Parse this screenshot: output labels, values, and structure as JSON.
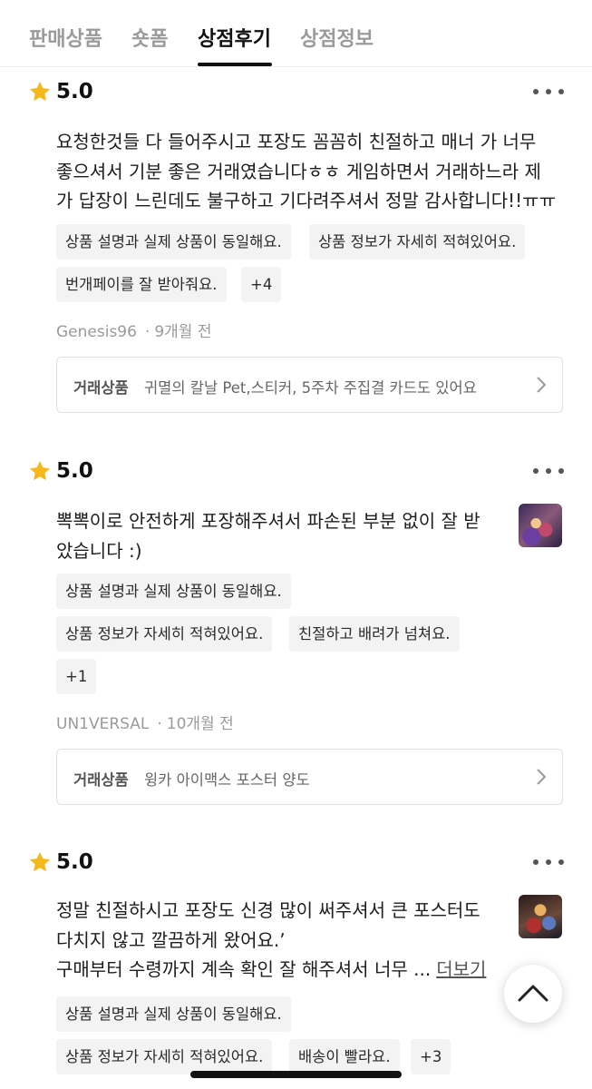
{
  "tabs": [
    {
      "label": "판매상품"
    },
    {
      "label": "숏폼"
    },
    {
      "label": "상점후기"
    },
    {
      "label": "상점정보"
    }
  ],
  "active_tab": "상점후기",
  "icons": {
    "rating": "star-icon",
    "menu": "more-icon",
    "trade": "chevron-right-icon",
    "scroll_top": "chevron-up-icon"
  },
  "colors": {
    "star": "#f5b81c",
    "active_tab": "#111111",
    "inactive_tab": "#9a9a9a",
    "chip_bg": "#f3f3f3"
  },
  "trade_label": "거래상품",
  "reviews": [
    {
      "rating": "5.0",
      "text_lines": [
        "요청한것들 다 들어주시고 포장도 꼼꼼히 친절하고 매너 가 너무",
        "좋으셔서 기분 좋은 거래였습니다ㅎㅎ 게임하면서 거래하느라 제",
        "가 답장이 느린데도 불구하고 기다려주셔서 정말 감사합니다!!ㅠㅠ"
      ],
      "tags": [
        "상품 설명과 실제 상품이 동일해요.",
        "상품 정보가 자세히 적혀있어요.",
        "번개페이를 잘 받아줘요.",
        "+4"
      ],
      "author": "Genesis96",
      "time": "9개월 전",
      "product": "귀멸의 칼날  Pet,스티커, 5주차 주집결 카드도 있어요"
    },
    {
      "rating": "5.0",
      "text_lines": [
        "뽁뽁이로 안전하게 포장해주셔서 파손된 부분 없이 잘 받",
        "았습니다 :)"
      ],
      "tags": [
        "상품 설명과 실제 상품이 동일해요.",
        "상품 정보가 자세히 적혀있어요.",
        "친절하고 배려가 넘쳐요.",
        "+1"
      ],
      "author": "UN1VERSAL",
      "time": "10개월 전",
      "product": "윙카 아이맥스 포스터 양도"
    },
    {
      "rating": "5.0",
      "text_lines": [
        "정말 친절하시고 포장도 신경 많이 써주셔서 큰 포스터도",
        "다치지 않고 깔끔하게 왔어요.ʼ",
        "구매부터 수령까지 계속 확인 잘 해주셔서 너무  ..."
      ],
      "more_label": "더보기",
      "tags": [
        "상품 설명과 실제 상품이 동일해요.",
        "상품 정보가 자세히 적혀있어요.",
        "배송이 빨라요.",
        "+3"
      ]
    }
  ]
}
